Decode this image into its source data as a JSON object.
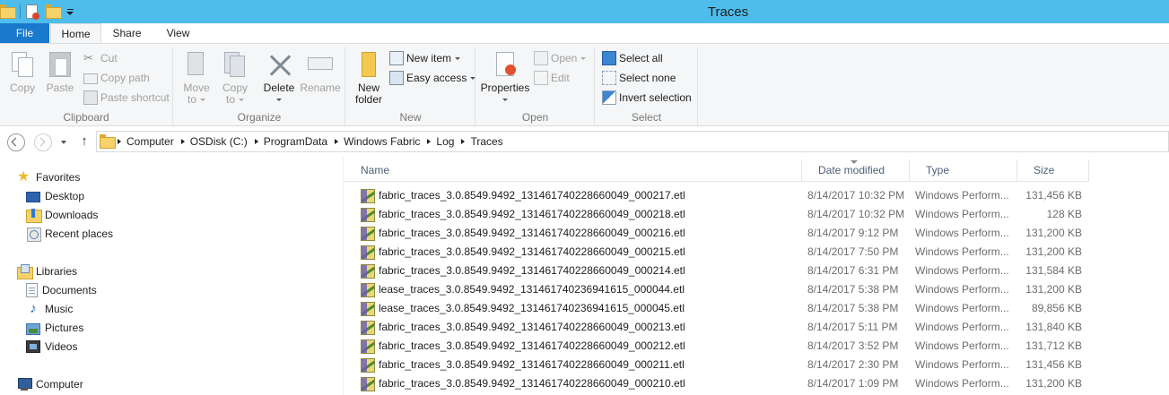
{
  "window": {
    "title": "Traces"
  },
  "ribbon": {
    "tabs": [
      {
        "label": "File"
      },
      {
        "label": "Home"
      },
      {
        "label": "Share"
      },
      {
        "label": "View"
      }
    ],
    "clipboard": {
      "group_label": "Clipboard",
      "copy": "Copy",
      "paste": "Paste",
      "cut": "Cut",
      "copy_path": "Copy path",
      "paste_shortcut": "Paste shortcut"
    },
    "organize": {
      "group_label": "Organize",
      "move_to_1": "Move",
      "move_to_2": "to",
      "copy_to_1": "Copy",
      "copy_to_2": "to",
      "delete": "Delete",
      "rename": "Rename"
    },
    "new": {
      "group_label": "New",
      "new_folder_1": "New",
      "new_folder_2": "folder",
      "new_item": "New item",
      "easy_access": "Easy access"
    },
    "open": {
      "group_label": "Open",
      "properties": "Properties",
      "open": "Open",
      "edit": "Edit"
    },
    "select": {
      "group_label": "Select",
      "select_all": "Select all",
      "select_none": "Select none",
      "invert_selection": "Invert selection"
    }
  },
  "address": {
    "crumbs": [
      "Computer",
      "OSDisk (C:)",
      "ProgramData",
      "Windows Fabric",
      "Log",
      "Traces"
    ]
  },
  "navpane": {
    "favorites": "Favorites",
    "desktop": "Desktop",
    "downloads": "Downloads",
    "recent_places": "Recent places",
    "libraries": "Libraries",
    "documents": "Documents",
    "music": "Music",
    "pictures": "Pictures",
    "videos": "Videos",
    "computer": "Computer"
  },
  "filelist": {
    "columns": {
      "name": "Name",
      "date_modified": "Date modified",
      "type": "Type",
      "size": "Size"
    },
    "files": [
      {
        "name": "fabric_traces_3.0.8549.9492_131461740228660049_000217.etl",
        "date": "8/14/2017 10:32 PM",
        "type": "Windows Perform...",
        "size": "131,456 KB"
      },
      {
        "name": "fabric_traces_3.0.8549.9492_131461740228660049_000218.etl",
        "date": "8/14/2017 10:32 PM",
        "type": "Windows Perform...",
        "size": "128 KB"
      },
      {
        "name": "fabric_traces_3.0.8549.9492_131461740228660049_000216.etl",
        "date": "8/14/2017 9:12 PM",
        "type": "Windows Perform...",
        "size": "131,200 KB"
      },
      {
        "name": "fabric_traces_3.0.8549.9492_131461740228660049_000215.etl",
        "date": "8/14/2017 7:50 PM",
        "type": "Windows Perform...",
        "size": "131,200 KB"
      },
      {
        "name": "fabric_traces_3.0.8549.9492_131461740228660049_000214.etl",
        "date": "8/14/2017 6:31 PM",
        "type": "Windows Perform...",
        "size": "131,584 KB"
      },
      {
        "name": "lease_traces_3.0.8549.9492_131461740236941615_000044.etl",
        "date": "8/14/2017 5:38 PM",
        "type": "Windows Perform...",
        "size": "131,200 KB"
      },
      {
        "name": "lease_traces_3.0.8549.9492_131461740236941615_000045.etl",
        "date": "8/14/2017 5:38 PM",
        "type": "Windows Perform...",
        "size": "89,856 KB"
      },
      {
        "name": "fabric_traces_3.0.8549.9492_131461740228660049_000213.etl",
        "date": "8/14/2017 5:11 PM",
        "type": "Windows Perform...",
        "size": "131,840 KB"
      },
      {
        "name": "fabric_traces_3.0.8549.9492_131461740228660049_000212.etl",
        "date": "8/14/2017 3:52 PM",
        "type": "Windows Perform...",
        "size": "131,712 KB"
      },
      {
        "name": "fabric_traces_3.0.8549.9492_131461740228660049_000211.etl",
        "date": "8/14/2017 2:30 PM",
        "type": "Windows Perform...",
        "size": "131,456 KB"
      },
      {
        "name": "fabric_traces_3.0.8549.9492_131461740228660049_000210.etl",
        "date": "8/14/2017 1:09 PM",
        "type": "Windows Perform...",
        "size": "131,200 KB"
      }
    ]
  }
}
